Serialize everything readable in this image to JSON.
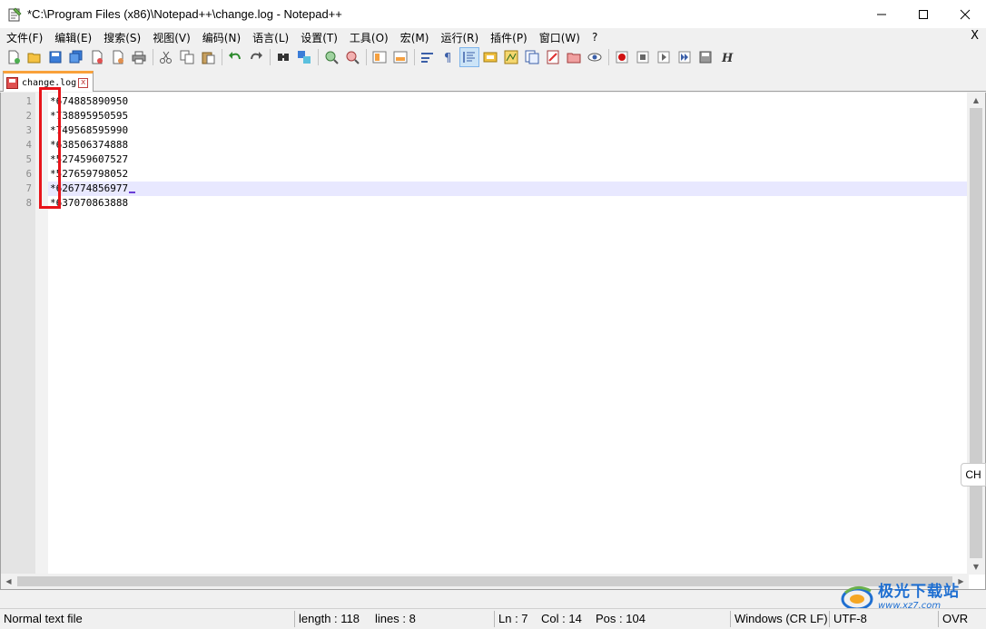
{
  "window": {
    "title": "*C:\\Program Files (x86)\\Notepad++\\change.log - Notepad++",
    "minimize_icon": "minimize-icon",
    "maximize_icon": "maximize-icon",
    "close_icon": "close-icon"
  },
  "menu": {
    "items": [
      "文件(F)",
      "编辑(E)",
      "搜索(S)",
      "视图(V)",
      "编码(N)",
      "语言(L)",
      "设置(T)",
      "工具(O)",
      "宏(M)",
      "运行(R)",
      "插件(P)",
      "窗口(W)",
      "?"
    ],
    "close_label": "X"
  },
  "toolbar": {
    "icons": [
      "new-file-icon",
      "open-file-icon",
      "save-icon",
      "save-all-icon",
      "close-icon",
      "close-all-icon",
      "print-icon",
      "cut-icon",
      "copy-icon",
      "paste-icon",
      "undo-icon",
      "redo-icon",
      "find-icon",
      "replace-icon",
      "zoom-in-icon",
      "zoom-out-icon",
      "sync-vertical-icon",
      "sync-horizontal-icon",
      "word-wrap-icon",
      "show-all-chars-icon",
      "indent-guide-icon",
      "user-language-icon",
      "document-map-icon",
      "function-list-icon",
      "folder-workspace-icon",
      "monitoring-icon",
      "record-macro-icon",
      "stop-record-icon",
      "play-macro-icon",
      "run-macro-multiple-icon",
      "save-macro-icon",
      "hex-editor-icon"
    ],
    "active_icon": "indent-guide-icon"
  },
  "tab": {
    "label": "change.log",
    "close_glyph": "x"
  },
  "editor": {
    "line_numbers": [
      "1",
      "2",
      "3",
      "4",
      "5",
      "6",
      "7",
      "8"
    ],
    "lines": [
      "*674885890950",
      "*738895950595",
      "*749568595990",
      "*638506374888",
      "*527459607527",
      "*527659798052",
      "*626774856977",
      "*637070863888"
    ],
    "current_line": 7,
    "highlight_color": "#e8141a"
  },
  "statusbar": {
    "file_type": "Normal text file",
    "length": "length : 118",
    "lines": "lines : 8",
    "ln": "Ln : 7",
    "col": "Col : 14",
    "pos": "Pos : 104",
    "eol": "Windows (CR LF)",
    "encoding": "UTF-8",
    "mode": "OVR"
  },
  "ime": {
    "label": "CH"
  },
  "watermark": {
    "name": "极光下载站",
    "url": "www.xz7.com"
  }
}
